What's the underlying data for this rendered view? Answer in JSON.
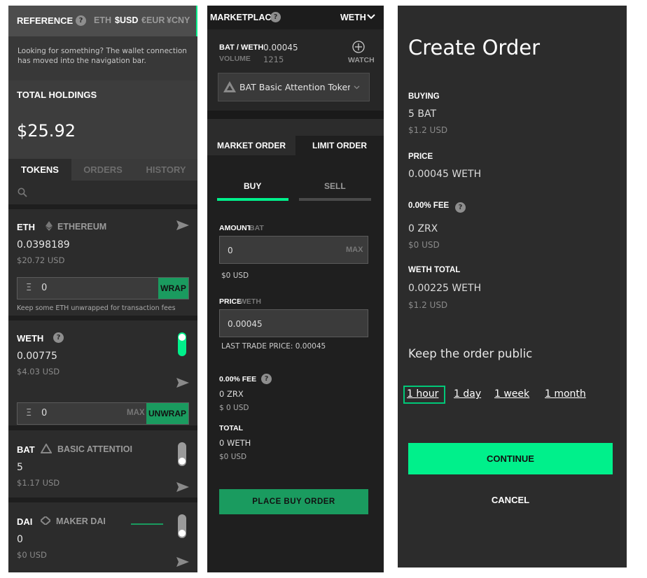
{
  "reference": {
    "title": "REFERENCE",
    "currencies": [
      "ETH",
      "$USD",
      "€EUR",
      "¥CNY"
    ],
    "selected": "$USD"
  },
  "notice": "Looking for something? The wallet connection has moved into the navigation bar.",
  "holdings": {
    "label": "TOTAL HOLDINGS",
    "value": "$25.92"
  },
  "token_tabs": [
    "TOKENS",
    "ORDERS",
    "HISTORY"
  ],
  "tokens": [
    {
      "symbol": "ETH",
      "name": "ETHEREUM",
      "balance": "0.0398189",
      "usd": "$20.72 USD",
      "input_value": "0",
      "input_prefix": "Ξ",
      "action": "WRAP",
      "note": "Keep some ETH unwrapped for transaction fees"
    },
    {
      "symbol": "WETH",
      "balance": "0.00775",
      "usd": "$4.03 USD",
      "input_value": "0",
      "input_prefix": "Ξ",
      "max": "MAX",
      "action": "UNWRAP",
      "toggle": "on"
    },
    {
      "symbol": "BAT",
      "name": "BASIC ATTENTIOI",
      "balance": "5",
      "usd": "$1.17 USD",
      "toggle": "off"
    },
    {
      "symbol": "DAI",
      "name": "MAKER DAI",
      "balance": "0",
      "usd": "$0 USD",
      "toggle": "off"
    }
  ],
  "marketplace": {
    "title": "MARKETPLACE",
    "currency": "WETH",
    "pair": "BAT / WETH",
    "price": "0.00045",
    "volume_label": "VOLUME",
    "volume": "1215",
    "watch": "WATCH",
    "token_select": "BAT  Basic Attention Toker",
    "order_tabs": [
      "MARKET ORDER",
      "LIMIT ORDER"
    ],
    "side_tabs": [
      "BUY",
      "SELL"
    ],
    "amount_label": "AMOUNT",
    "amount_unit": "BAT",
    "amount_value": "0",
    "amount_max": "MAX",
    "amount_usd": "$0 USD",
    "price_label": "PRICE",
    "price_unit": "WETH",
    "price_value": "0.00045",
    "last_trade": "LAST TRADE PRICE: 0.00045",
    "fee_label": "0.00% FEE",
    "fee_value": "0 ZRX",
    "fee_usd": "$ 0 USD",
    "total_label": "TOTAL",
    "total_value": "0 WETH",
    "total_usd": "$0 USD",
    "place_button": "PLACE BUY ORDER"
  },
  "create_order": {
    "title": "Create Order",
    "buying_label": "BUYING",
    "buying_value": "5 BAT",
    "buying_usd": "$1.2 USD",
    "price_label": "PRICE",
    "price_value": "0.00045 WETH",
    "fee_label": "0.00% FEE",
    "fee_value": "0 ZRX",
    "fee_usd": "$0 USD",
    "total_label": "WETH TOTAL",
    "total_value": "0.00225 WETH",
    "total_usd": "$1.2 USD",
    "public_label": "Keep the order public",
    "durations": [
      "1 hour",
      "1 day",
      "1 week",
      "1 month"
    ],
    "continue": "CONTINUE",
    "cancel": "CANCEL"
  },
  "colors": {
    "accent": "#00f08b",
    "green_btn": "#1a9b5f",
    "panel": "#2c2c2c"
  }
}
